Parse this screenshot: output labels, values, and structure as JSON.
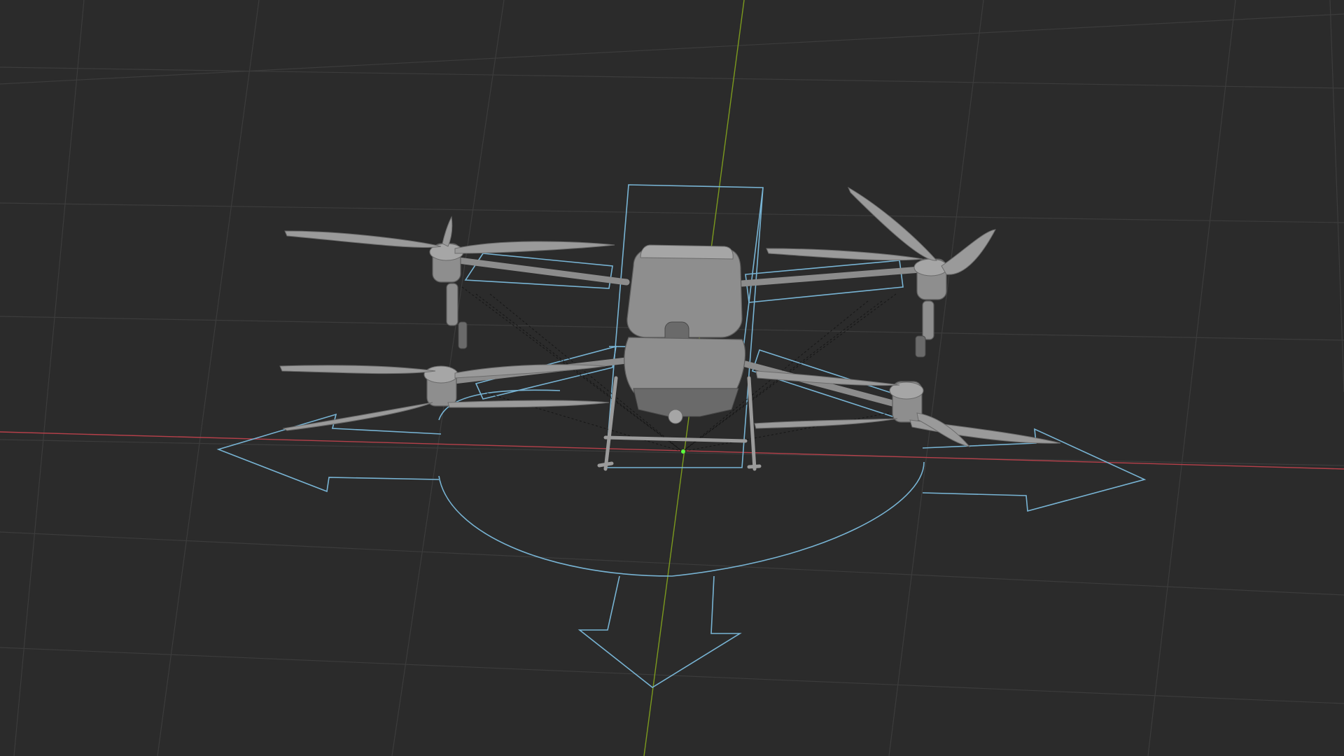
{
  "app": {
    "view": "3D Viewport"
  },
  "colors": {
    "background": "#2b2b2b",
    "grid": "#3c3c3c",
    "axis_x": "#b6404a",
    "axis_y": "#7c9a1e",
    "rig_controls": "#78b4d4",
    "model": "#8e8e8e"
  },
  "scene": {
    "object": "drone-model",
    "rig_controls": [
      "root-control-circle",
      "arrow-left",
      "arrow-right",
      "arrow-down",
      "body-bounding-box"
    ]
  }
}
